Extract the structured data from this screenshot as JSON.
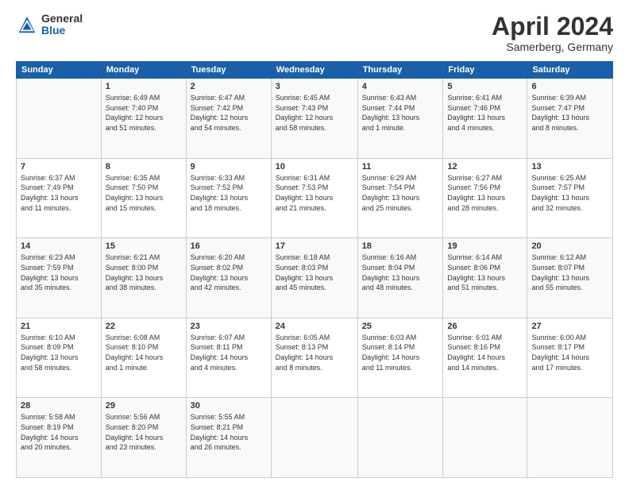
{
  "header": {
    "logo_general": "General",
    "logo_blue": "Blue",
    "month_title": "April 2024",
    "location": "Samerberg, Germany"
  },
  "days_of_week": [
    "Sunday",
    "Monday",
    "Tuesday",
    "Wednesday",
    "Thursday",
    "Friday",
    "Saturday"
  ],
  "weeks": [
    [
      {
        "day": "",
        "info": ""
      },
      {
        "day": "1",
        "info": "Sunrise: 6:49 AM\nSunset: 7:40 PM\nDaylight: 12 hours\nand 51 minutes."
      },
      {
        "day": "2",
        "info": "Sunrise: 6:47 AM\nSunset: 7:42 PM\nDaylight: 12 hours\nand 54 minutes."
      },
      {
        "day": "3",
        "info": "Sunrise: 6:45 AM\nSunset: 7:43 PM\nDaylight: 12 hours\nand 58 minutes."
      },
      {
        "day": "4",
        "info": "Sunrise: 6:43 AM\nSunset: 7:44 PM\nDaylight: 13 hours\nand 1 minute."
      },
      {
        "day": "5",
        "info": "Sunrise: 6:41 AM\nSunset: 7:46 PM\nDaylight: 13 hours\nand 4 minutes."
      },
      {
        "day": "6",
        "info": "Sunrise: 6:39 AM\nSunset: 7:47 PM\nDaylight: 13 hours\nand 8 minutes."
      }
    ],
    [
      {
        "day": "7",
        "info": "Sunrise: 6:37 AM\nSunset: 7:49 PM\nDaylight: 13 hours\nand 11 minutes."
      },
      {
        "day": "8",
        "info": "Sunrise: 6:35 AM\nSunset: 7:50 PM\nDaylight: 13 hours\nand 15 minutes."
      },
      {
        "day": "9",
        "info": "Sunrise: 6:33 AM\nSunset: 7:52 PM\nDaylight: 13 hours\nand 18 minutes."
      },
      {
        "day": "10",
        "info": "Sunrise: 6:31 AM\nSunset: 7:53 PM\nDaylight: 13 hours\nand 21 minutes."
      },
      {
        "day": "11",
        "info": "Sunrise: 6:29 AM\nSunset: 7:54 PM\nDaylight: 13 hours\nand 25 minutes."
      },
      {
        "day": "12",
        "info": "Sunrise: 6:27 AM\nSunset: 7:56 PM\nDaylight: 13 hours\nand 28 minutes."
      },
      {
        "day": "13",
        "info": "Sunrise: 6:25 AM\nSunset: 7:57 PM\nDaylight: 13 hours\nand 32 minutes."
      }
    ],
    [
      {
        "day": "14",
        "info": "Sunrise: 6:23 AM\nSunset: 7:59 PM\nDaylight: 13 hours\nand 35 minutes."
      },
      {
        "day": "15",
        "info": "Sunrise: 6:21 AM\nSunset: 8:00 PM\nDaylight: 13 hours\nand 38 minutes."
      },
      {
        "day": "16",
        "info": "Sunrise: 6:20 AM\nSunset: 8:02 PM\nDaylight: 13 hours\nand 42 minutes."
      },
      {
        "day": "17",
        "info": "Sunrise: 6:18 AM\nSunset: 8:03 PM\nDaylight: 13 hours\nand 45 minutes."
      },
      {
        "day": "18",
        "info": "Sunrise: 6:16 AM\nSunset: 8:04 PM\nDaylight: 13 hours\nand 48 minutes."
      },
      {
        "day": "19",
        "info": "Sunrise: 6:14 AM\nSunset: 8:06 PM\nDaylight: 13 hours\nand 51 minutes."
      },
      {
        "day": "20",
        "info": "Sunrise: 6:12 AM\nSunset: 8:07 PM\nDaylight: 13 hours\nand 55 minutes."
      }
    ],
    [
      {
        "day": "21",
        "info": "Sunrise: 6:10 AM\nSunset: 8:09 PM\nDaylight: 13 hours\nand 58 minutes."
      },
      {
        "day": "22",
        "info": "Sunrise: 6:08 AM\nSunset: 8:10 PM\nDaylight: 14 hours\nand 1 minute."
      },
      {
        "day": "23",
        "info": "Sunrise: 6:07 AM\nSunset: 8:11 PM\nDaylight: 14 hours\nand 4 minutes."
      },
      {
        "day": "24",
        "info": "Sunrise: 6:05 AM\nSunset: 8:13 PM\nDaylight: 14 hours\nand 8 minutes."
      },
      {
        "day": "25",
        "info": "Sunrise: 6:03 AM\nSunset: 8:14 PM\nDaylight: 14 hours\nand 11 minutes."
      },
      {
        "day": "26",
        "info": "Sunrise: 6:01 AM\nSunset: 8:16 PM\nDaylight: 14 hours\nand 14 minutes."
      },
      {
        "day": "27",
        "info": "Sunrise: 6:00 AM\nSunset: 8:17 PM\nDaylight: 14 hours\nand 17 minutes."
      }
    ],
    [
      {
        "day": "28",
        "info": "Sunrise: 5:58 AM\nSunset: 8:19 PM\nDaylight: 14 hours\nand 20 minutes."
      },
      {
        "day": "29",
        "info": "Sunrise: 5:56 AM\nSunset: 8:20 PM\nDaylight: 14 hours\nand 23 minutes."
      },
      {
        "day": "30",
        "info": "Sunrise: 5:55 AM\nSunset: 8:21 PM\nDaylight: 14 hours\nand 26 minutes."
      },
      {
        "day": "",
        "info": ""
      },
      {
        "day": "",
        "info": ""
      },
      {
        "day": "",
        "info": ""
      },
      {
        "day": "",
        "info": ""
      }
    ]
  ]
}
